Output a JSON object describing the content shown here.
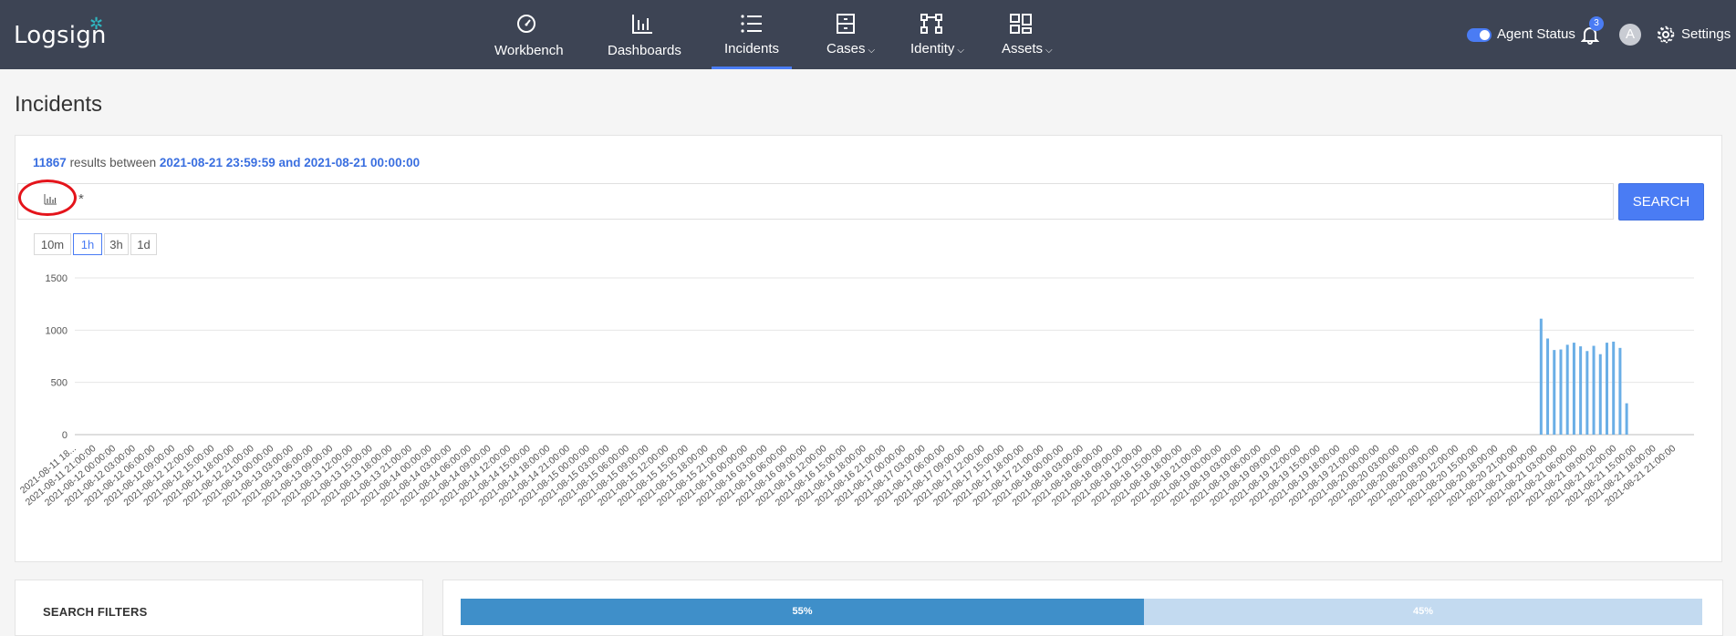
{
  "app": {
    "logo_text": "Logsign"
  },
  "nav": {
    "items": [
      {
        "label": "Workbench",
        "icon": "gauge-icon",
        "active": false,
        "dropdown": false
      },
      {
        "label": "Dashboards",
        "icon": "bar-chart-icon",
        "active": false,
        "dropdown": false
      },
      {
        "label": "Incidents",
        "icon": "list-icon",
        "active": true,
        "dropdown": false
      },
      {
        "label": "Cases",
        "icon": "cabinet-icon",
        "active": false,
        "dropdown": true
      },
      {
        "label": "Identity",
        "icon": "nodes-icon",
        "active": false,
        "dropdown": true
      },
      {
        "label": "Assets",
        "icon": "grid-icon",
        "active": false,
        "dropdown": true
      }
    ],
    "accent": "#4a7cf4"
  },
  "tools": {
    "agent_status_label": "Agent Status",
    "agent_status_on": true,
    "notification_count": "3",
    "avatar_initial": "A",
    "settings_label": "Settings"
  },
  "page": {
    "title": "Incidents"
  },
  "results": {
    "count": "11867",
    "between_text": "results between",
    "range": "2021-08-21 23:59:59 and 2021-08-21 00:00:00"
  },
  "search": {
    "query": "*",
    "button_label": "SEARCH"
  },
  "intervals": [
    {
      "label": "10m",
      "active": false
    },
    {
      "label": "1h",
      "active": true
    },
    {
      "label": "3h",
      "active": false
    },
    {
      "label": "1d",
      "active": false
    }
  ],
  "chart_data": {
    "type": "bar",
    "color": "#6aaee6",
    "ylim": [
      0,
      1500
    ],
    "yticks": [
      0,
      500,
      1000,
      1500
    ],
    "grid": true,
    "categories": [
      "2021-08-11 18...",
      "2021-08-11 21:00:00",
      "2021-08-12 00:00:00",
      "2021-08-12 03:00:00",
      "2021-08-12 06:00:00",
      "2021-08-12 09:00:00",
      "2021-08-12 12:00:00",
      "2021-08-12 15:00:00",
      "2021-08-12 18:00:00",
      "2021-08-12 21:00:00",
      "2021-08-13 00:00:00",
      "2021-08-13 03:00:00",
      "2021-08-13 06:00:00",
      "2021-08-13 09:00:00",
      "2021-08-13 12:00:00",
      "2021-08-13 15:00:00",
      "2021-08-13 18:00:00",
      "2021-08-13 21:00:00",
      "2021-08-14 00:00:00",
      "2021-08-14 03:00:00",
      "2021-08-14 06:00:00",
      "2021-08-14 09:00:00",
      "2021-08-14 12:00:00",
      "2021-08-14 15:00:00",
      "2021-08-14 18:00:00",
      "2021-08-14 21:00:00",
      "2021-08-15 00:00:00",
      "2021-08-15 03:00:00",
      "2021-08-15 06:00:00",
      "2021-08-15 09:00:00",
      "2021-08-15 12:00:00",
      "2021-08-15 15:00:00",
      "2021-08-15 18:00:00",
      "2021-08-15 21:00:00",
      "2021-08-16 00:00:00",
      "2021-08-16 03:00:00",
      "2021-08-16 06:00:00",
      "2021-08-16 09:00:00",
      "2021-08-16 12:00:00",
      "2021-08-16 15:00:00",
      "2021-08-16 18:00:00",
      "2021-08-16 21:00:00",
      "2021-08-17 00:00:00",
      "2021-08-17 03:00:00",
      "2021-08-17 06:00:00",
      "2021-08-17 09:00:00",
      "2021-08-17 12:00:00",
      "2021-08-17 15:00:00",
      "2021-08-17 18:00:00",
      "2021-08-17 21:00:00",
      "2021-08-18 00:00:00",
      "2021-08-18 03:00:00",
      "2021-08-18 06:00:00",
      "2021-08-18 09:00:00",
      "2021-08-18 12:00:00",
      "2021-08-18 15:00:00",
      "2021-08-18 18:00:00",
      "2021-08-18 21:00:00",
      "2021-08-19 00:00:00",
      "2021-08-19 03:00:00",
      "2021-08-19 06:00:00",
      "2021-08-19 09:00:00",
      "2021-08-19 12:00:00",
      "2021-08-19 15:00:00",
      "2021-08-19 18:00:00",
      "2021-08-19 21:00:00",
      "2021-08-20 00:00:00",
      "2021-08-20 03:00:00",
      "2021-08-20 06:00:00",
      "2021-08-20 09:00:00",
      "2021-08-20 12:00:00",
      "2021-08-20 15:00:00",
      "2021-08-20 18:00:00",
      "2021-08-20 21:00:00",
      "2021-08-21 00:00:00",
      "2021-08-21 03:00:00",
      "2021-08-21 06:00:00",
      "2021-08-21 09:00:00",
      "2021-08-21 12:00:00",
      "2021-08-21 15:00:00",
      "2021-08-21 18:00:00",
      "2021-08-21 21:00:00"
    ],
    "bars": [
      {
        "x": "2021-08-21 00:00",
        "y": 1110
      },
      {
        "x": "2021-08-21 01:00",
        "y": 920
      },
      {
        "x": "2021-08-21 02:00",
        "y": 810
      },
      {
        "x": "2021-08-21 03:00",
        "y": 815
      },
      {
        "x": "2021-08-21 04:00",
        "y": 860
      },
      {
        "x": "2021-08-21 05:00",
        "y": 880
      },
      {
        "x": "2021-08-21 06:00",
        "y": 845
      },
      {
        "x": "2021-08-21 07:00",
        "y": 800
      },
      {
        "x": "2021-08-21 08:00",
        "y": 850
      },
      {
        "x": "2021-08-21 09:00",
        "y": 770
      },
      {
        "x": "2021-08-21 10:00",
        "y": 880
      },
      {
        "x": "2021-08-21 11:00",
        "y": 890
      },
      {
        "x": "2021-08-21 12:00",
        "y": 830
      },
      {
        "x": "2021-08-21 13:00",
        "y": 300
      }
    ]
  },
  "filters": {
    "title": "SEARCH FILTERS"
  },
  "split_bar": {
    "left_value": 55,
    "left_label": "55%",
    "right_value": 45,
    "right_label": "45%"
  }
}
